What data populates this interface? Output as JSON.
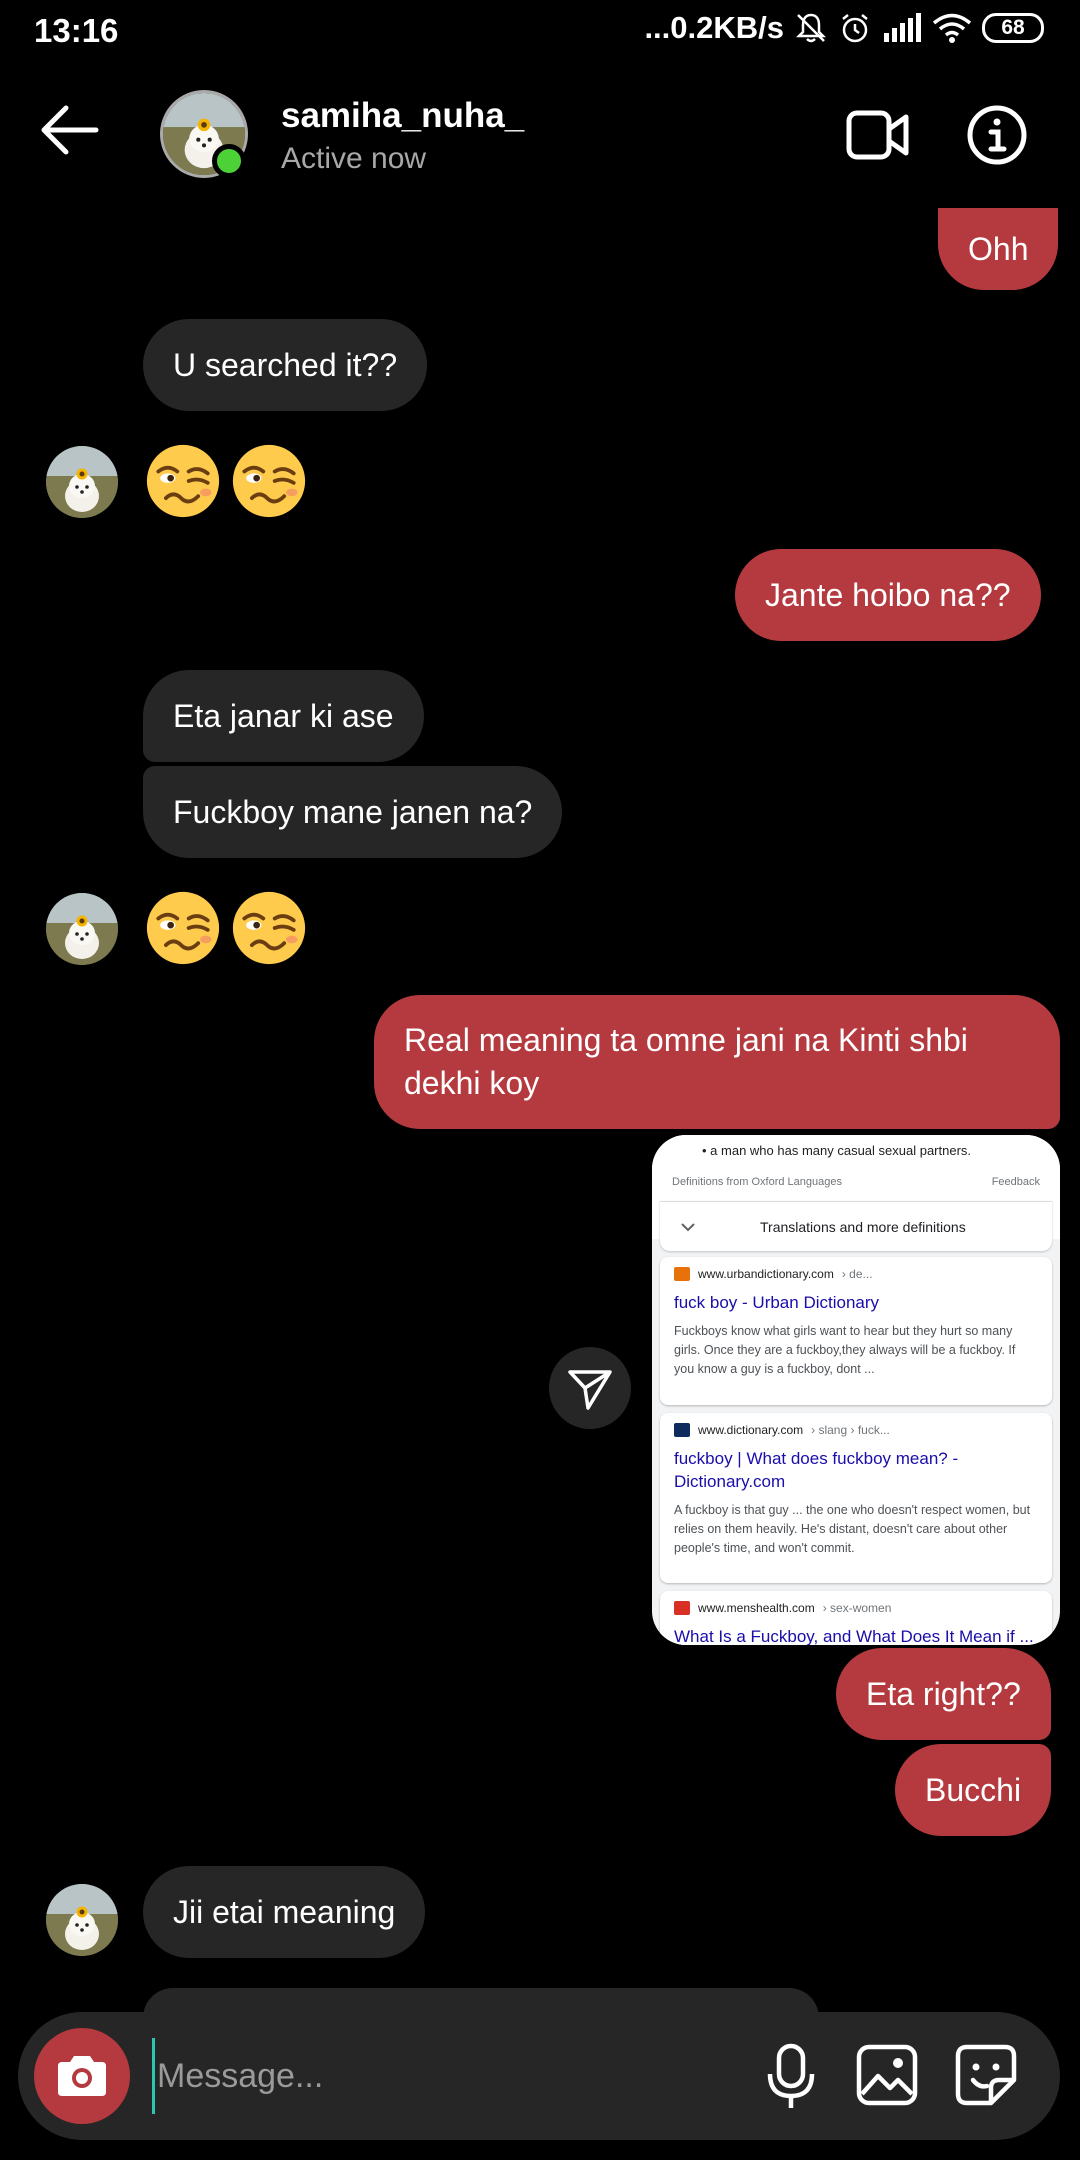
{
  "status_bar": {
    "time": "13:16",
    "network_speed": "...0.2KB/s",
    "battery": "68"
  },
  "header": {
    "username": "samiha_nuha_",
    "status": "Active now"
  },
  "messages": [
    {
      "side": "out",
      "text": "Ohh"
    },
    {
      "side": "in",
      "text": "U searched it??"
    },
    {
      "side": "in",
      "type": "emoji",
      "text": "🥴🥴"
    },
    {
      "side": "out",
      "text": "Jante hoibo na??"
    },
    {
      "side": "in",
      "text": "Eta janar ki ase"
    },
    {
      "side": "in",
      "text": "Fuckboy mane janen na?"
    },
    {
      "side": "in",
      "type": "emoji",
      "text": "🥴🥴"
    },
    {
      "side": "out",
      "text": "Real meaning ta omne jani na Kinti shbi dekhi koy"
    },
    {
      "side": "out",
      "text": "Eta right??"
    },
    {
      "side": "out",
      "text": "Bucchi"
    },
    {
      "side": "in",
      "text": "Jii  etai meaning"
    }
  ],
  "shared_image": {
    "bullet": "a man who has many casual sexual partners.",
    "definitions_source": "Definitions from Oxford Languages",
    "feedback": "Feedback",
    "translations": "Translations and more definitions",
    "results": [
      {
        "site": "www.urbandictionary.com",
        "crumb": "› de...",
        "title": "fuck boy - Urban Dictionary",
        "snippet": "Fuckboys know what girls want to hear but they hurt so many girls. Once they are a fuckboy,they always will be a fuckboy. If you know a guy is a fuckboy, dont ...",
        "fav_color": "#e8710a"
      },
      {
        "site": "www.dictionary.com",
        "crumb": "› slang › fuck...",
        "title": "fuckboy | What does fuckboy mean? - Dictionary.com",
        "snippet": "A fuckboy is that guy ... the one who doesn't respect women, but relies on them heavily. He's distant, doesn't care about other people's time, and won't commit.",
        "fav_color": "#0f2a5c"
      },
      {
        "site": "www.menshealth.com",
        "crumb": "› sex-women",
        "title": "What Is a Fuckboy, and What Does It Mean if ...",
        "snippet": "",
        "fav_color": "#d93025"
      }
    ]
  },
  "composer": {
    "placeholder": "Message..."
  },
  "colors": {
    "outgoing_bubble": "#b43a3f",
    "incoming_bubble": "#262626",
    "online": "#4cd137"
  }
}
